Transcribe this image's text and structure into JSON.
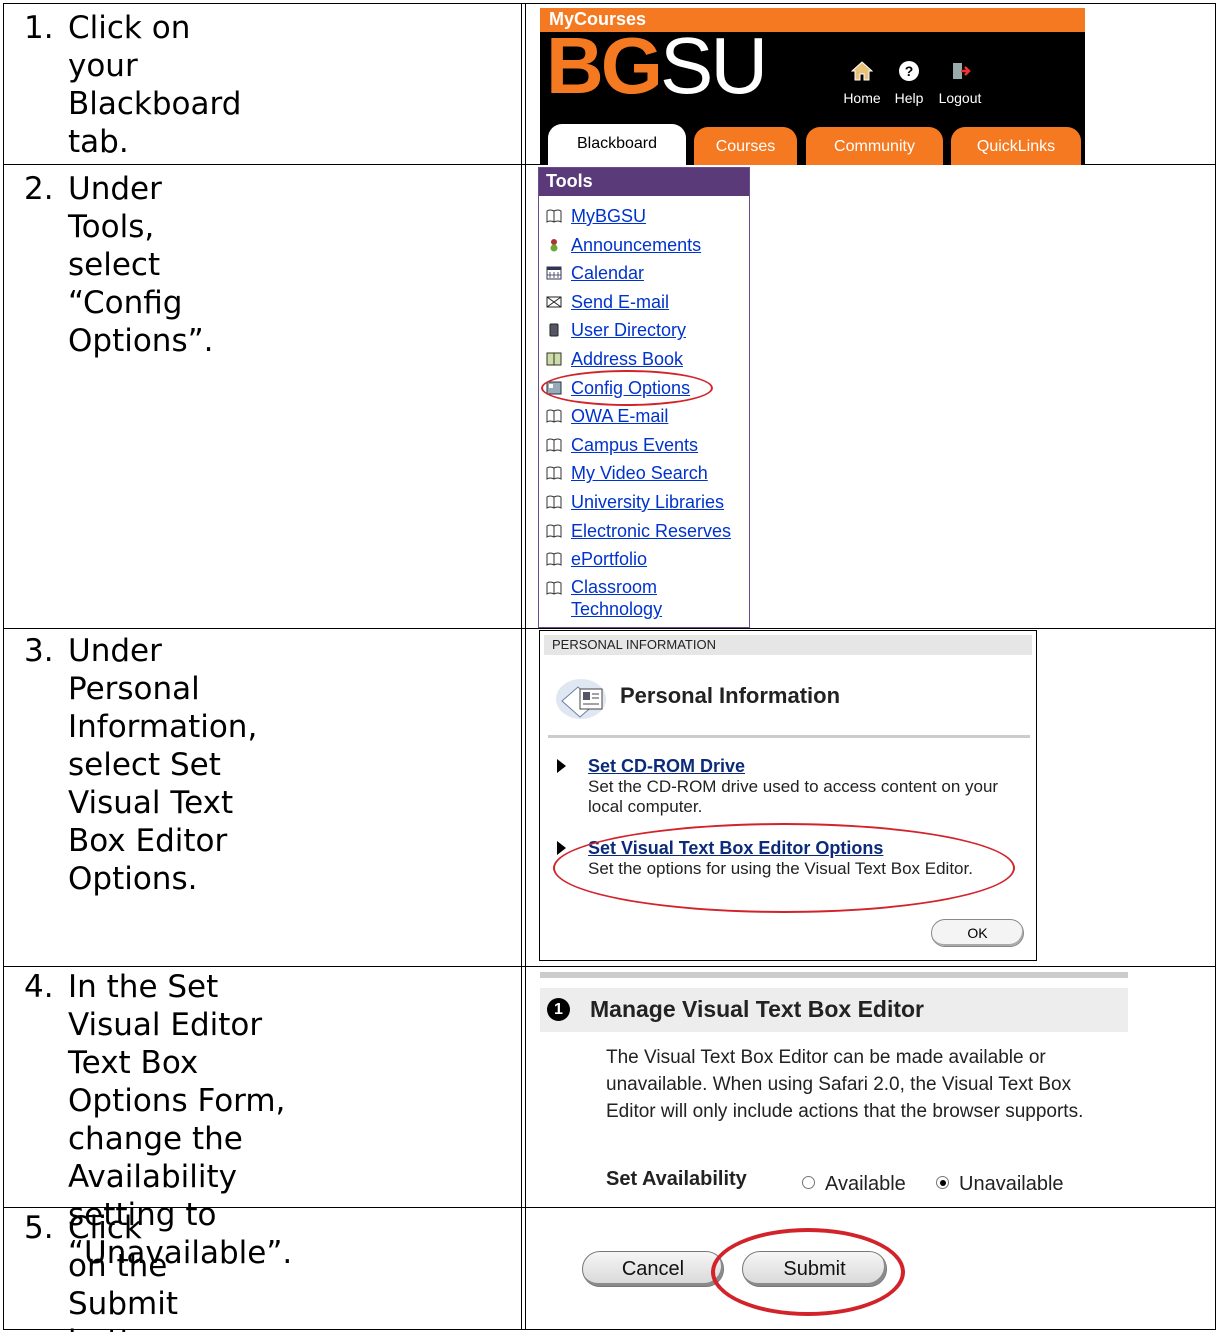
{
  "steps": [
    {
      "num": "1.",
      "text": "Click on your Blackboard\ntab."
    },
    {
      "num": "2.",
      "text": "Under Tools, select “Config\nOptions”."
    },
    {
      "num": "3.",
      "text": "Under Personal\nInformation, select Set\nVisual Text Box Editor\nOptions."
    },
    {
      "num": "4.",
      "text": "In the Set Visual Editor\nText Box Options Form,\nchange the Availability\nsetting to “Unavailable”."
    },
    {
      "num": "5.",
      "text": "Click on the Submit\nbutton."
    }
  ],
  "header": {
    "site": "MyCourses",
    "logo_bold": "BG",
    "logo_thin": "SU",
    "tools": [
      "Home",
      "Help",
      "Logout"
    ],
    "tabs": [
      "Blackboard",
      "Courses",
      "Community",
      "QuickLinks"
    ],
    "brand_color": "#f47920"
  },
  "tools_panel": {
    "title": "Tools",
    "items": [
      "MyBGSU",
      "Announcements",
      "Calendar",
      "Send E-mail",
      "User Directory",
      "Address Book",
      "Config Options",
      "OWA E-mail",
      "Campus Events",
      "My Video Search",
      "University Libraries",
      "Electronic Reserves",
      "ePortfolio",
      "Classroom Technology"
    ]
  },
  "personal_info": {
    "strip": "PERSONAL INFORMATION",
    "heading": "Personal Information",
    "items": [
      {
        "link": "Set CD-ROM Drive",
        "desc": "Set the CD-ROM drive used to access content on your local computer."
      },
      {
        "link": "Set Visual Text Box Editor Options",
        "desc": "Set the options for using the Visual Text Box Editor."
      }
    ],
    "ok": "OK"
  },
  "manage": {
    "badge": "1",
    "heading": "Manage Visual Text Box Editor",
    "desc": "The Visual Text Box Editor can be made available or unavailable. When using Safari 2.0, the Visual Text Box Editor will only include actions that the browser supports.",
    "label": "Set Availability",
    "options": [
      "Available",
      "Unavailable"
    ],
    "selected": "Unavailable"
  },
  "buttons": {
    "cancel": "Cancel",
    "submit": "Submit"
  },
  "highlight_color": "#d2232a"
}
